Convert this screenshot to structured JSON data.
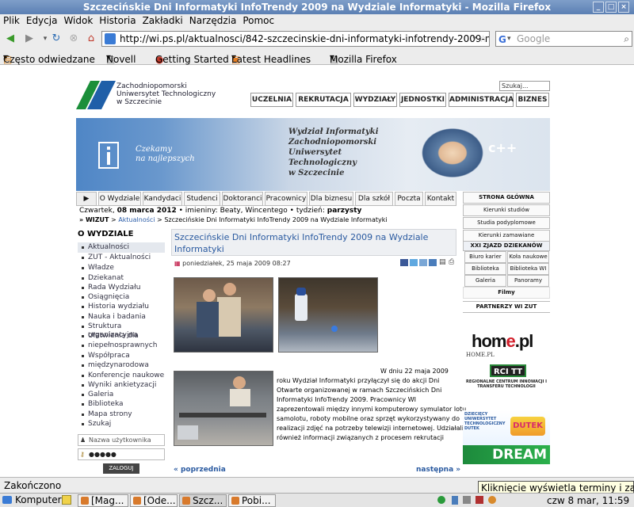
{
  "window": {
    "title": "Szczecińskie Dni Informatyki InfoTrendy 2009 na Wydziale Informatyki - Mozilla Firefox"
  },
  "menu": [
    "Plik",
    "Edycja",
    "Widok",
    "Historia",
    "Zakładki",
    "Narzędzia",
    "Pomoc"
  ],
  "nav": {
    "url": "http://wi.ps.pl/aktualnosci/842-szczecinskie-dni-informatyki-infotrendy-2009-na-wydzia",
    "search_placeholder": "Google",
    "search_engine": "G"
  },
  "bookmarks": [
    "Często odwiedzane",
    "Novell",
    "Getting Started",
    "Latest Headlines",
    "Mozilla Firefox"
  ],
  "page": {
    "uni_name": [
      "Zachodniopomorski",
      "Uniwersytet Technologiczny",
      "w Szczecinie"
    ],
    "search_label": "Szukaj...",
    "top_nav": [
      "UCZELNIA",
      "REKRUTACJA",
      "WYDZIAŁY",
      "JEDNOSTKI",
      "ADMINISTRACJA",
      "BIZNES"
    ],
    "banner": {
      "slogan1": "Czekamy",
      "slogan2": "na najlepszych",
      "faculty": [
        "Wydział Informatyki",
        "Zachodniopomorski",
        "Uniwersytet",
        "Technologiczny",
        "w Szczecinie"
      ]
    },
    "sec_nav": [
      "O Wydziale",
      "Kandydaci",
      "Studenci",
      "Doktoranci",
      "Pracownicy",
      "Dla biznesu",
      "Dla szkół",
      "Poczta",
      "Kontakt"
    ],
    "date_prefix": "Czwartek,",
    "date_bold": "08 marca 2012",
    "names_prefix": "• imieniny:",
    "names": "Beaty, Wincentego",
    "week_prefix": "• tydzień:",
    "week": "parzysty",
    "breadcrumb": {
      "root": "» WIZUT",
      "sep1": " > ",
      "section": "Aktualności",
      "sep2": " > ",
      "current": "Szczecińskie Dni Informatyki InfoTrendy 2009 na Wydziale Informatyki"
    },
    "left_heading": "O WYDZIALE",
    "left_menu": [
      "Aktualności",
      "ZUT - Aktualności",
      "Władze",
      "Dziekanat",
      "Rada Wydziału",
      "Osiągnięcia",
      "Historia wydziału",
      "Nauka i badania",
      "Struktura organizacyjna",
      "Ułatwienia dla",
      "niepełnosprawnych",
      "Współpraca",
      "międzynarodowa",
      "Konferencje naukowe",
      "Wyniki ankietyzacji",
      "Galeria",
      "Biblioteka",
      "Mapa strony",
      "Szukaj"
    ],
    "login_placeholder": "Nazwa użytkownika",
    "password_value": "●●●●●",
    "login_button": "ZALOGUJ",
    "article": {
      "title_line1": "Szczecińskie Dni Informatyki InfoTrendy 2009 na Wydziale",
      "title_line2": "Informatyki",
      "date": "poniedziałek, 25 maja 2009 08:27",
      "lead": "W dniu 22 maja 2009",
      "body": [
        "roku Wydział Informatyki przyłączył się do akcji Dni",
        "Otwarte organizowanej w ramach Szczecińskich Dni",
        "Informatyki InfoTrendy 2009. Pracownicy WI",
        "zaprezentowali między innymi komputerowy symulator lotu",
        "samolotu, roboty mobilne oraz sprzęt wykorzystywany do",
        "realizacji zdjęć na potrzeby telewizji internetowej. Udziałali",
        "również informacji związanych z procesem rekrutacji"
      ],
      "prev": "« poprzednia",
      "next": "następna »"
    },
    "right": {
      "strona": "STRONA GŁÓWNA",
      "kierunki": "Kierunki studiów",
      "podyplomowe": "Studia podyplomowe",
      "zamawiane": "Kierunki zamawiane",
      "zjazd": "XXI ZJAZD DZIEKANÓW",
      "biuro": "Biuro karier",
      "kola": "Koła naukowe",
      "bzut": "Biblioteka ZUT",
      "bwi": "Biblioteka WI",
      "galeria": "Galeria",
      "panoramy": "Panoramy",
      "filmy": "Filmy",
      "partnerzy": "PARTNERZY WI ZUT",
      "home_logo_a": "hom",
      "home_logo_b": "e",
      "home_logo_c": ".pl",
      "home_small": "HOME.PL",
      "rcitt": "RCI TT",
      "rcitt_text": "REGIONALNE CENTRUM INNOWACJI I TRANSFERU TECHNOLOGII",
      "dutek_text": "DZIECIĘCY UNIWERSYTET TECHNOLOGICZNY DUTEK",
      "dutek": "DUTEK",
      "dream": "DREAM"
    }
  },
  "status": "Zakończono",
  "tooltip": "Kliknięcie wyświetla terminy i zadania",
  "taskbar": {
    "start": "Komputer",
    "tasks": [
      "[Mag...",
      "[Ode...",
      "Szcz...",
      "Pobi..."
    ],
    "clock_day": "czw",
    "clock_date": "8 mar, 11:59"
  }
}
